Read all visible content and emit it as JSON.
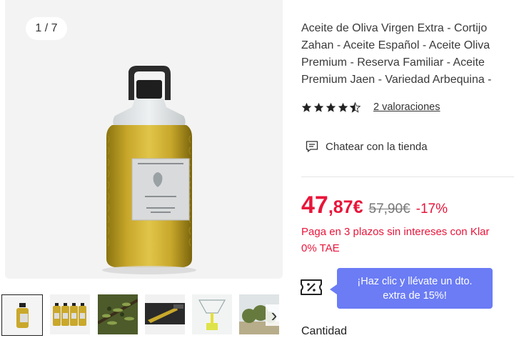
{
  "gallery": {
    "counter": "1 / 7",
    "main_image": "olive-oil-bottle",
    "thumbnails": [
      {
        "name": "olive-oil-bottle",
        "active": true
      },
      {
        "name": "olive-oil-bottles-group",
        "active": false
      },
      {
        "name": "olive-tree-branch",
        "active": false
      },
      {
        "name": "olive-oil-pour",
        "active": false
      },
      {
        "name": "olive-oil-glass-drop",
        "active": false
      },
      {
        "name": "olive-grove",
        "active": false
      }
    ],
    "next_icon": "chevron-right-icon"
  },
  "product": {
    "title": "Aceite de Oliva Virgen Extra - Cortijo Zahan - Aceite Español - Aceite Oliva Premium - Reserva Familiar - Aceite Premium Jaen - Variedad Arbequina -",
    "rating": 4.5,
    "rating_max": 5,
    "reviews": "2 valoraciones",
    "chat": "Chatear con la tienda"
  },
  "price": {
    "integer": "47",
    "decimal": ",87€",
    "old": "57,90€",
    "discount": "-17%",
    "installments_line1": "Paga en 3 plazos sin intereses con Klar",
    "installments_line2": "0% TAE"
  },
  "promo": {
    "line1": "¡Haz clic y llévate un dto.",
    "line2": "extra de 15%!"
  },
  "quantity": {
    "label": "Cantidad"
  },
  "colors": {
    "accent_red": "#e8153a",
    "promo_bg": "#6b7cf5",
    "oil": "#c9a82b"
  }
}
